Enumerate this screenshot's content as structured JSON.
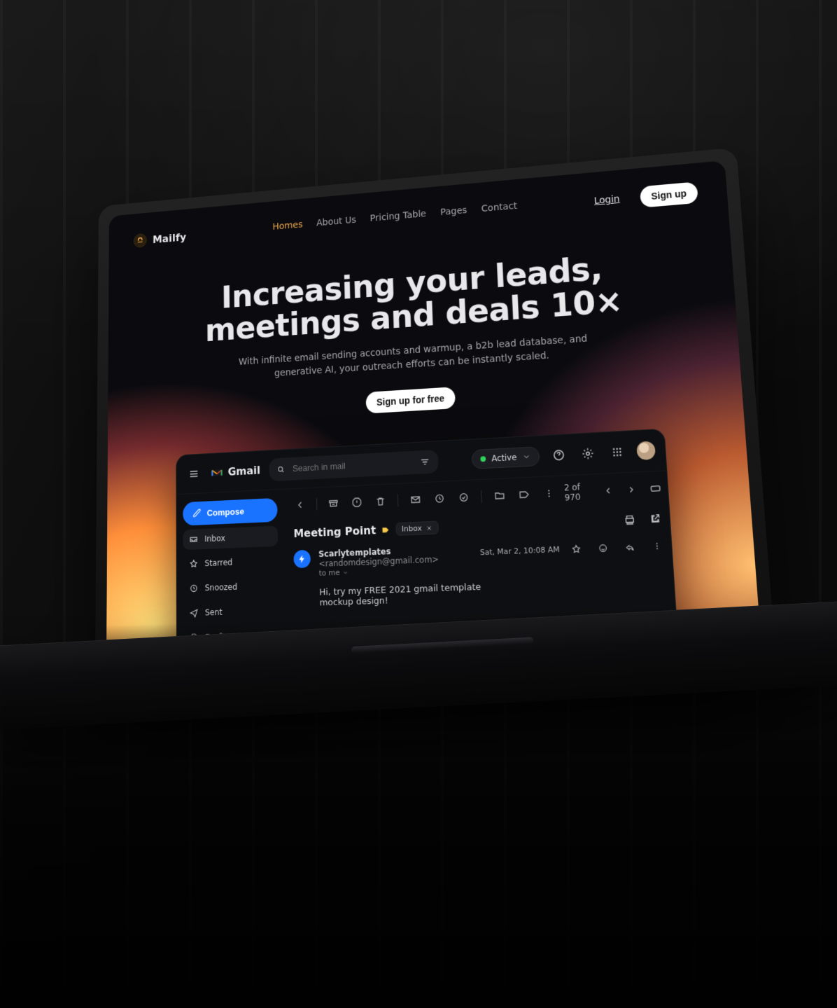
{
  "brand": {
    "name": "Mailfy"
  },
  "nav": {
    "items": [
      {
        "label": "Homes",
        "active": true
      },
      {
        "label": "About Us"
      },
      {
        "label": "Pricing Table"
      },
      {
        "label": "Pages"
      },
      {
        "label": "Contact"
      }
    ],
    "login": "Login",
    "signup": "Sign up"
  },
  "hero": {
    "headline_line1": "Increasing your leads,",
    "headline_line2": "meetings and deals 10×",
    "subtitle": "With infinite email sending accounts and warmup, a b2b lead database, and generative AI, your outreach efforts can be instantly scaled.",
    "cta": "Sign up for free"
  },
  "gmail": {
    "brand": "Gmail",
    "search_placeholder": "Search in mail",
    "status_label": "Active",
    "compose": "Compose",
    "sidebar": [
      {
        "icon": "inbox",
        "label": "Inbox",
        "active": true
      },
      {
        "icon": "star",
        "label": "Starred"
      },
      {
        "icon": "clock",
        "label": "Snoozed"
      },
      {
        "icon": "send",
        "label": "Sent"
      },
      {
        "icon": "file",
        "label": "Drafts"
      }
    ],
    "pager": "2 of 970",
    "thread": {
      "title": "Meeting Point",
      "label_chip": "Inbox",
      "sender_name": "Scarlytemplates",
      "sender_email": "<randomdesign@gmail.com>",
      "sender_to": "to me",
      "date": "Sat, Mar 2, 10:08 AM",
      "body_line1": "Hi, try my FREE 2021 gmail template",
      "body_line2": "mockup design!"
    }
  }
}
